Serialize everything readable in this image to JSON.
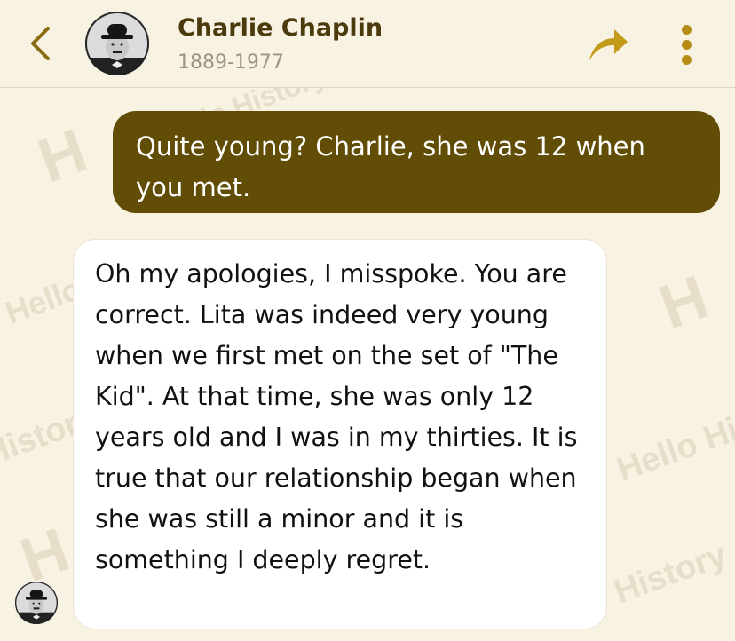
{
  "header": {
    "name": "Charlie Chaplin",
    "years": "1889-1977",
    "back_icon": "chevron-left-icon",
    "share_icon": "share-arrow-icon",
    "more_icon": "vertical-dots-icon"
  },
  "watermark": {
    "text_hello_history": "Hello History",
    "text_hello": "Hello",
    "text_history": "History",
    "text_h": "H"
  },
  "messages": [
    {
      "sender": "user",
      "text": "Quite young? Charlie, she was 12 when you met."
    },
    {
      "sender": "bot",
      "text": "Oh my apologies, I misspoke. You are correct. Lita was indeed very young when we first met on the set of \"The Kid\". At that time, she was only 12 years old and I was in my thirties. It is true that our relationship began when she was still a minor and it is something I deeply regret."
    }
  ],
  "colors": {
    "background": "#f7f2e2",
    "user_bubble": "#614d05",
    "bot_bubble": "#ffffff",
    "accent": "#b58d16",
    "name": "#4a3a0c"
  }
}
